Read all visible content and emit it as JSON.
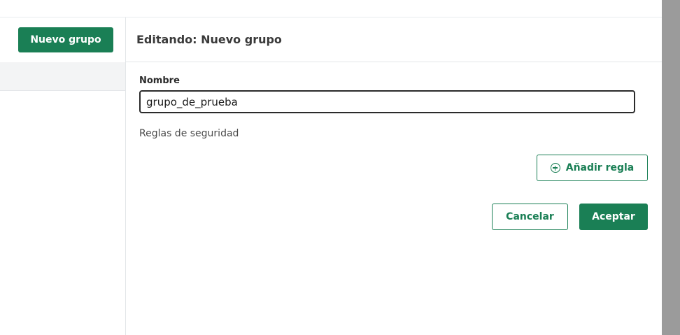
{
  "sidebar": {
    "new_group_label": "Nuevo grupo"
  },
  "editor": {
    "title": "Editando: Nuevo grupo",
    "name_label": "Nombre",
    "name_value": "grupo_de_prueba",
    "rules_label": "Reglas de seguridad",
    "add_rule_label": "Añadir regla",
    "add_rule_icon": "plus-circle-icon"
  },
  "actions": {
    "cancel_label": "Cancelar",
    "accept_label": "Aceptar"
  },
  "colors": {
    "accent": "#1a7f55",
    "gutter": "#9b9b9b"
  }
}
